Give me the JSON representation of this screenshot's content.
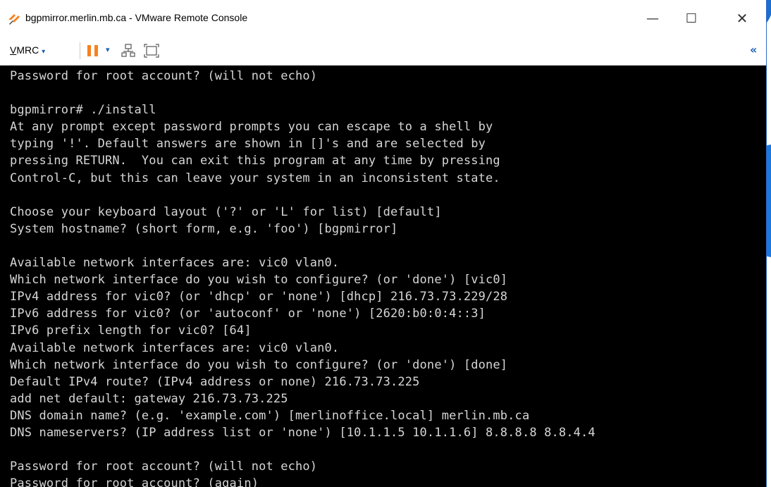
{
  "window": {
    "title": "bgpmirror.merlin.mb.ca - VMware Remote Console",
    "app_icon": "vmware-logo-icon",
    "controls": {
      "minimize": "—",
      "maximize": "☐",
      "close": "✕"
    }
  },
  "toolbar": {
    "vmrc_menu_first": "V",
    "vmrc_menu_rest": "MRC",
    "vmrc_caret": "▾",
    "pause_icon": "pause-icon",
    "pause_caret": "▾",
    "network_icon": "network-icon",
    "fullscreen_icon": "fullscreen-icon",
    "collapse_label": "«",
    "accent": "#f58220"
  },
  "console": {
    "lines": [
      "Password for root account? (will not echo)",
      "",
      "bgpmirror# ./install",
      "At any prompt except password prompts you can escape to a shell by",
      "typing '!'. Default answers are shown in []'s and are selected by",
      "pressing RETURN.  You can exit this program at any time by pressing",
      "Control-C, but this can leave your system in an inconsistent state.",
      "",
      "Choose your keyboard layout ('?' or 'L' for list) [default]",
      "System hostname? (short form, e.g. 'foo') [bgpmirror]",
      "",
      "Available network interfaces are: vic0 vlan0.",
      "Which network interface do you wish to configure? (or 'done') [vic0]",
      "IPv4 address for vic0? (or 'dhcp' or 'none') [dhcp] 216.73.73.229/28",
      "IPv6 address for vic0? (or 'autoconf' or 'none') [2620:b0:0:4::3]",
      "IPv6 prefix length for vic0? [64]",
      "Available network interfaces are: vic0 vlan0.",
      "Which network interface do you wish to configure? (or 'done') [done]",
      "Default IPv4 route? (IPv4 address or none) 216.73.73.225",
      "add net default: gateway 216.73.73.225",
      "DNS domain name? (e.g. 'example.com') [merlinoffice.local] merlin.mb.ca",
      "DNS nameservers? (IP address list or 'none') [10.1.1.5 10.1.1.6] 8.8.8.8 8.8.4.4",
      "",
      "Password for root account? (will not echo)",
      "Password for root account? (again) "
    ]
  }
}
